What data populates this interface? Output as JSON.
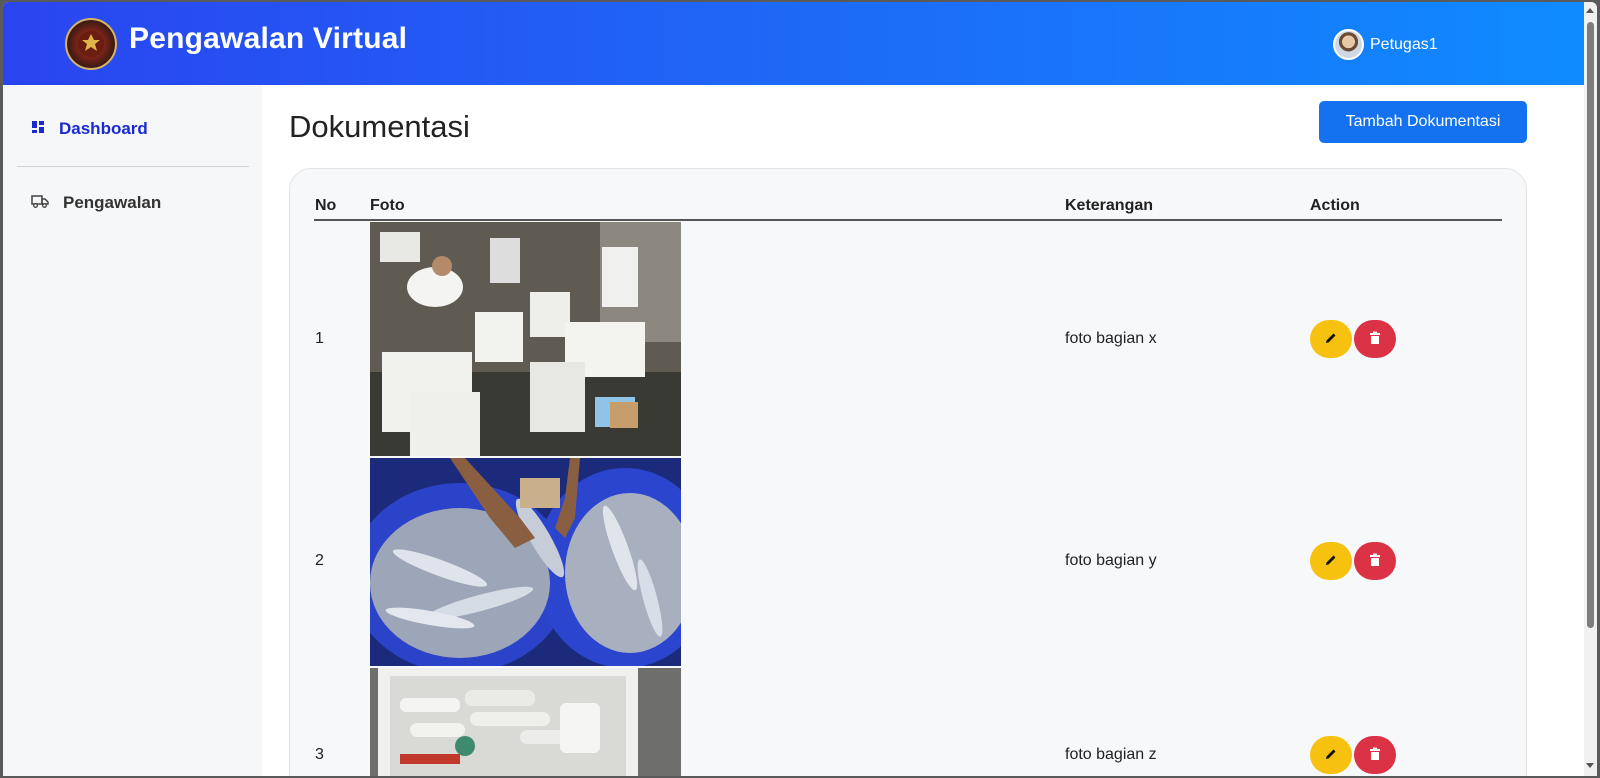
{
  "header": {
    "title": "Pengawalan Virtual",
    "user_name": "Petugas1"
  },
  "sidebar": {
    "items": [
      {
        "label": "Dashboard",
        "icon": "dashboard-icon",
        "active": true
      },
      {
        "label": "Pengawalan",
        "icon": "truck-icon",
        "active": false
      }
    ]
  },
  "main": {
    "page_title": "Dokumentasi",
    "add_button": "Tambah Dokumentasi",
    "table": {
      "headers": [
        "No",
        "Foto",
        "Keterangan",
        "Action"
      ],
      "rows": [
        {
          "no": "1",
          "keterangan": "foto bagian x"
        },
        {
          "no": "2",
          "keterangan": "foto bagian y"
        },
        {
          "no": "3",
          "keterangan": "foto bagian z"
        }
      ]
    }
  },
  "colors": {
    "header_start": "#2a45f0",
    "header_end": "#0f8bff",
    "accent": "#1472f0",
    "edit": "#f7c10f",
    "delete": "#dc3246",
    "active_nav": "#1a2ad0"
  }
}
